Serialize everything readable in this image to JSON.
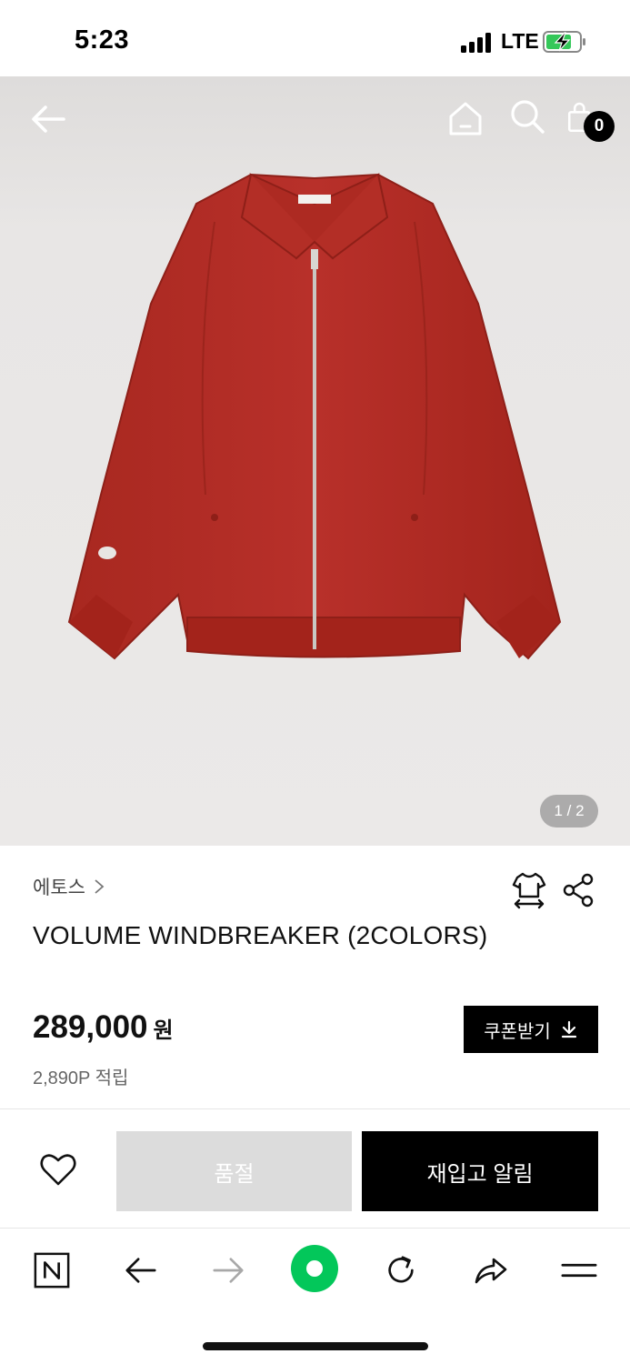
{
  "status_bar": {
    "time": "5:23",
    "network": "LTE",
    "icons": [
      "signal-bars-icon",
      "battery-charging-icon"
    ]
  },
  "header": {
    "icons": [
      "back-arrow-icon",
      "home-icon",
      "search-icon",
      "shopping-bag-icon"
    ],
    "cart_count": "0"
  },
  "gallery": {
    "page_indicator": "1 / 2",
    "current_page": 1,
    "total_pages": 2
  },
  "product": {
    "brand": "에토스",
    "title": "VOLUME WINDBREAKER (2COLORS)",
    "price": "289,000",
    "currency": "원",
    "points": "2,890P 적립",
    "coupon_label": "쿠폰받기",
    "colors": {
      "jacket": "#b32a21"
    },
    "icons": [
      "size-guide-icon",
      "share-icon",
      "download-icon"
    ]
  },
  "purchase_bar": {
    "soldout_label": "품절",
    "restock_label": "재입고 알림",
    "icons": [
      "heart-icon"
    ]
  },
  "browser_toolbar": {
    "icons": [
      "naver-n-icon",
      "back-icon",
      "forward-icon",
      "green-dot-icon",
      "reload-icon",
      "share-arrow-icon",
      "menu-icon"
    ],
    "accent": "#03c75a"
  }
}
